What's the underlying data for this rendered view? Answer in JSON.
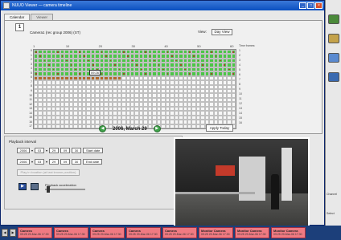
{
  "window": {
    "title": "NUUO Viewer — camera timeline"
  },
  "tabs": [
    {
      "label": "Calendar"
    },
    {
      "label": "Viewer"
    }
  ],
  "toolbar": {
    "camera_button": "1",
    "camera_name": "Camera1 (rec group 2006) (ST)",
    "view_label": "View:",
    "day_view_label": "Day View"
  },
  "timeline": {
    "top_ticks": [
      "1",
      "10",
      "20",
      "30",
      "40",
      "50",
      "60"
    ],
    "hours": [
      "0",
      "1",
      "2",
      "3",
      "4",
      "5",
      "6",
      "7",
      "8",
      "9",
      "10",
      "11",
      "12",
      "13",
      "14",
      "15",
      "16",
      "17"
    ],
    "right_legend": [
      "Time frames:",
      "1",
      "2",
      "3",
      "4",
      "5",
      "6",
      "7",
      "8",
      "9",
      "10",
      "11",
      "12",
      "13",
      "14",
      "15",
      "16"
    ],
    "cursor_time": "09:26",
    "date": "2006, March 29",
    "prev_label": "◀",
    "next_label": "▶",
    "apply_label": "Apply Today"
  },
  "playback": {
    "label": "Playback interval",
    "start": {
      "year": "2006",
      "month": "03",
      "day": "29",
      "hour": "09",
      "min": "30"
    },
    "end": {
      "year": "2006",
      "month": "03",
      "day": "29",
      "hour": "09",
      "min": "30"
    },
    "start_btn": "Start date",
    "end_btn": "End date",
    "disabled_btn": "Play in location (at last known position)",
    "play_label": "▶",
    "accel_label": "Playback acceleration"
  },
  "sidebar": {
    "note1": "Channel",
    "note2": "Select"
  },
  "taskbar": {
    "items": [
      {
        "name": "Camera",
        "time": "09:25 29-Mar-06 17:30"
      },
      {
        "name": "Camera",
        "time": "09:25 29-Mar-06 17:30"
      },
      {
        "name": "Camera",
        "time": "09:25 29-Mar-06 17:30"
      },
      {
        "name": "Camera",
        "time": "09:25 29-Mar-06 17:30"
      },
      {
        "name": "Camera",
        "time": "09:25 29-Mar-06 17:30"
      },
      {
        "name": "Monitor Camera",
        "time": "09:25 29-Mar-06 17:30"
      },
      {
        "name": "Monitor Camera",
        "time": "09:25 29-Mar-06 17:30"
      },
      {
        "name": "Monitor Camera",
        "time": "09:25 29-Mar-06 17:30"
      }
    ]
  },
  "colors": {
    "recorded": "#4cc648",
    "motion": "#b3682b",
    "titlebar": "#0a4fc0",
    "taskitem": "#f07a82"
  }
}
